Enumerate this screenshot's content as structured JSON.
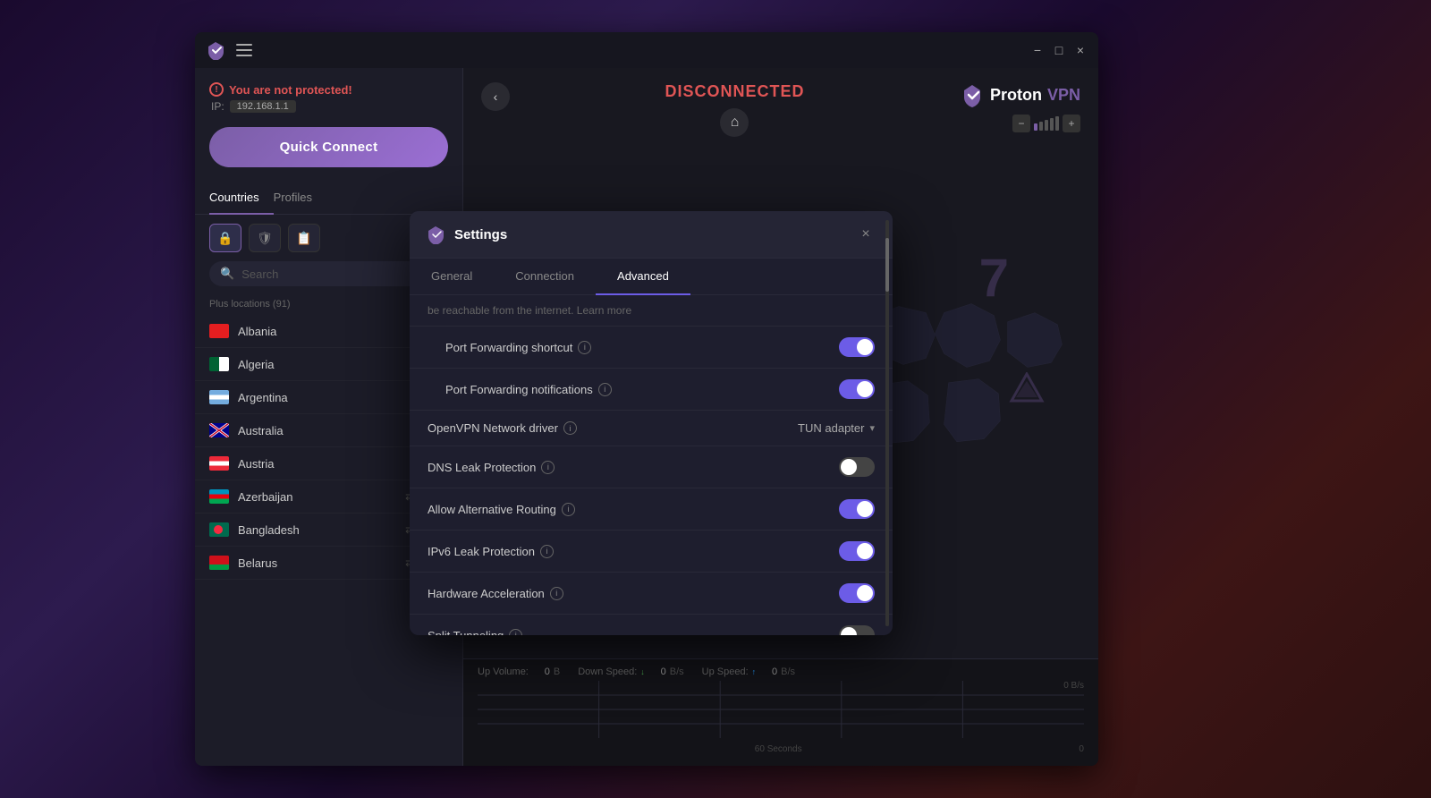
{
  "window": {
    "title": "ProtonVPN"
  },
  "titlebar": {
    "minimize": "−",
    "maximize": "□",
    "close": "×"
  },
  "left_panel": {
    "warning": "You are not protected!",
    "ip_label": "IP:",
    "ip_value": "192.168.1.1",
    "quick_connect": "Quick Connect",
    "tabs": [
      {
        "id": "countries",
        "label": "Countries",
        "active": true
      },
      {
        "id": "profiles",
        "label": "Profiles",
        "active": false
      }
    ],
    "filter_icons": [
      "lock",
      "shield",
      "edit"
    ],
    "search_placeholder": "Search",
    "plus_locations": "Plus locations (91)",
    "countries": [
      {
        "name": "Albania",
        "flag_class": "flag-albania",
        "has_globe": true
      },
      {
        "name": "Algeria",
        "flag_class": "flag-algeria",
        "has_globe": true
      },
      {
        "name": "Argentina",
        "flag_class": "flag-argentina",
        "has_globe": true
      },
      {
        "name": "Australia",
        "flag_class": "flag-australia",
        "has_globe": false
      },
      {
        "name": "Austria",
        "flag_class": "flag-austria",
        "has_globe": false
      },
      {
        "name": "Azerbaijan",
        "flag_class": "flag-azerbaijan",
        "has_globe": true,
        "has_chevron": true
      },
      {
        "name": "Bangladesh",
        "flag_class": "flag-bangladesh",
        "has_globe": true,
        "has_chevron": true
      },
      {
        "name": "Belarus",
        "flag_class": "flag-belarus",
        "has_globe": true,
        "has_chevron": true
      }
    ]
  },
  "right_panel": {
    "back_label": "<",
    "status": "DISCONNECTED",
    "brand_name": "Proton",
    "brand_vpn": "VPN",
    "graph_labels": {
      "left": "",
      "center": "60 Seconds",
      "right": "0",
      "speed": "0 B/s"
    },
    "stats": {
      "up_volume_label": "Up Volume:",
      "up_volume_value": "0",
      "up_volume_unit": "B",
      "down_speed_label": "Down Speed:",
      "down_speed_value": "0",
      "down_speed_unit": "B/s",
      "up_speed_label": "Up Speed:",
      "up_speed_value": "0",
      "up_speed_unit": "B/s"
    }
  },
  "settings": {
    "title": "Settings",
    "close": "×",
    "tabs": [
      {
        "id": "general",
        "label": "General",
        "active": false
      },
      {
        "id": "connection",
        "label": "Connection",
        "active": false
      },
      {
        "id": "advanced",
        "label": "Advanced",
        "active": true
      }
    ],
    "scroll_notice": "be reachable from the internet. Learn more",
    "rows": [
      {
        "id": "port_forwarding_shortcut",
        "label": "Port Forwarding shortcut",
        "has_info": true,
        "type": "toggle",
        "enabled": true,
        "indent": true
      },
      {
        "id": "port_forwarding_notifications",
        "label": "Port Forwarding notifications",
        "has_info": true,
        "type": "toggle",
        "enabled": true,
        "indent": true
      },
      {
        "id": "openvpn_driver",
        "label": "OpenVPN Network driver",
        "has_info": true,
        "type": "dropdown",
        "value": "TUN adapter"
      },
      {
        "id": "dns_leak",
        "label": "DNS Leak Protection",
        "has_info": true,
        "type": "toggle",
        "enabled": false
      },
      {
        "id": "alt_routing",
        "label": "Allow Alternative Routing",
        "has_info": true,
        "type": "toggle",
        "enabled": true
      },
      {
        "id": "ipv6_leak",
        "label": "IPv6 Leak Protection",
        "has_info": true,
        "type": "toggle",
        "enabled": true
      },
      {
        "id": "hw_acceleration",
        "label": "Hardware Acceleration",
        "has_info": true,
        "type": "toggle",
        "enabled": true
      },
      {
        "id": "split_tunneling",
        "label": "Split Tunneling",
        "has_info": true,
        "type": "toggle",
        "enabled": false
      }
    ]
  }
}
